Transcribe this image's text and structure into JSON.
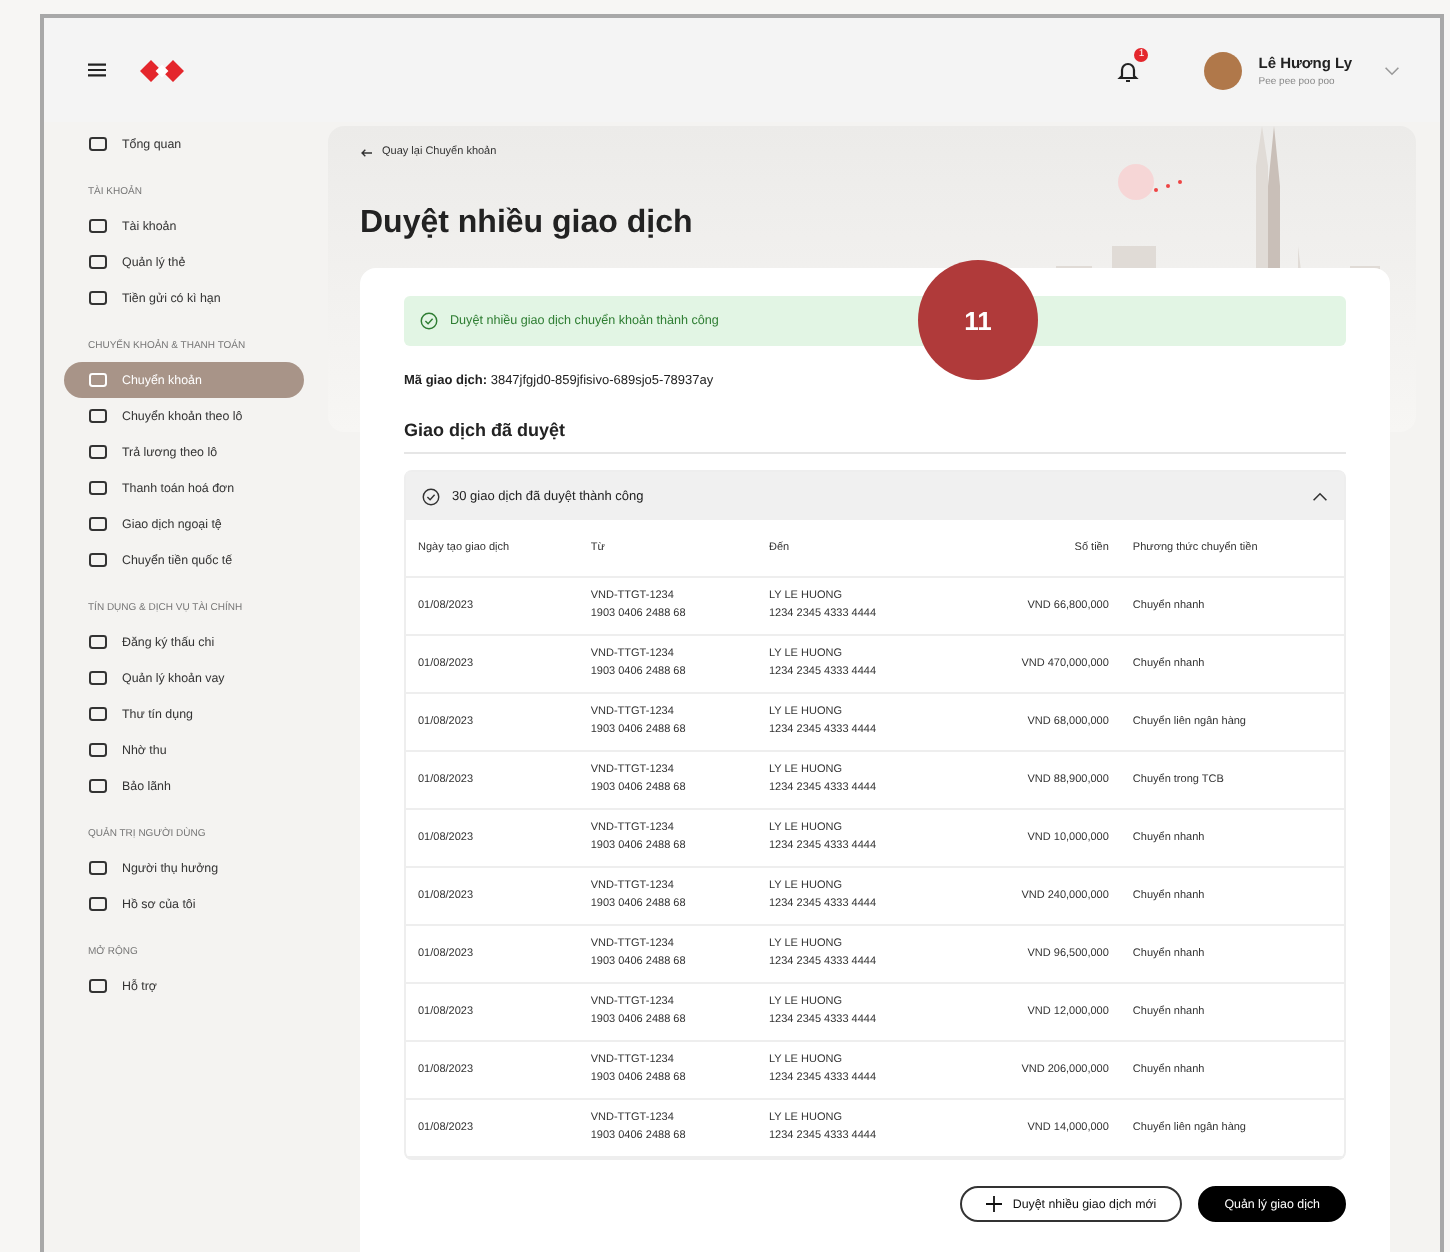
{
  "header": {
    "notification_count": "1",
    "user_name": "Lê Hương Ly",
    "user_subtitle": "Pee pee poo poo"
  },
  "sidebar": {
    "sections": [
      {
        "items": [
          {
            "label": "Tổng quan",
            "selected": false
          }
        ]
      },
      {
        "heading": "TÀI KHOẢN",
        "items": [
          {
            "label": "Tài khoản",
            "selected": false
          },
          {
            "label": "Quản lý thẻ",
            "selected": false
          },
          {
            "label": "Tiền gửi có kì hạn",
            "selected": false
          }
        ]
      },
      {
        "heading": "CHUYỂN KHOẢN & THANH TOÁN",
        "items": [
          {
            "label": "Chuyển khoản",
            "selected": true
          },
          {
            "label": "Chuyển khoản theo lô",
            "selected": false
          },
          {
            "label": "Trả lương theo lô",
            "selected": false
          },
          {
            "label": "Thanh toán hoá đơn",
            "selected": false
          },
          {
            "label": "Giao dịch ngoại tệ",
            "selected": false
          },
          {
            "label": "Chuyển tiền quốc tế",
            "selected": false
          }
        ]
      },
      {
        "heading": "TÍN DỤNG & DỊCH VỤ TÀI CHÍNH",
        "items": [
          {
            "label": "Đăng ký thấu chi",
            "selected": false
          },
          {
            "label": "Quản lý khoản vay",
            "selected": false
          },
          {
            "label": "Thư tín dụng",
            "selected": false
          },
          {
            "label": "Nhờ thu",
            "selected": false
          },
          {
            "label": "Bảo lãnh",
            "selected": false
          }
        ]
      },
      {
        "heading": "QUẢN TRỊ NGƯỜI DÙNG",
        "items": [
          {
            "label": "Người thụ hưởng",
            "selected": false
          },
          {
            "label": "Hồ sơ của tôi",
            "selected": false
          }
        ]
      },
      {
        "heading": "MỞ RỘNG",
        "items": [
          {
            "label": "Hỗ trợ",
            "selected": false
          }
        ]
      }
    ]
  },
  "back_link": "Quay lại Chuyển khoản",
  "title": "Duyệt nhiều giao dịch",
  "success_message": "Duyệt nhiều giao dịch chuyển khoản thành công",
  "transaction_id": "**Mã giao dịch:** 3847jfgjd0-859jfisivo-689sjo5-78937ay",
  "section_title": "Giao dịch đã duyệt",
  "accordion": {
    "label": "30 giao dịch đã duyệt thành công",
    "expanded": true
  },
  "step_marker": "11",
  "table": {
    "columns": [
      "Ngày tạo giao dịch",
      "Từ",
      "Đến",
      "Số tiền",
      "Phương thức chuyển tiền"
    ],
    "rows": [
      {
        "date": "01/08/2023",
        "from": [
          "VND-TTGT-1234",
          "1903 0406 2488 68"
        ],
        "to": [
          "LY LE HUONG",
          "1234 2345 4333 4444"
        ],
        "amount": "VND 66,800,000",
        "method": "Chuyển nhanh"
      },
      {
        "date": "01/08/2023",
        "from": [
          "VND-TTGT-1234",
          "1903 0406 2488 68"
        ],
        "to": [
          "LY LE HUONG",
          "1234 2345 4333 4444"
        ],
        "amount": "VND 470,000,000",
        "method": "Chuyển nhanh"
      },
      {
        "date": "01/08/2023",
        "from": [
          "VND-TTGT-1234",
          "1903 0406 2488 68"
        ],
        "to": [
          "LY LE HUONG",
          "1234 2345 4333 4444"
        ],
        "amount": "VND 68,000,000",
        "method": "Chuyển liên ngân hàng"
      },
      {
        "date": "01/08/2023",
        "from": [
          "VND-TTGT-1234",
          "1903 0406 2488 68"
        ],
        "to": [
          "LY LE HUONG",
          "1234 2345 4333 4444"
        ],
        "amount": "VND 88,900,000",
        "method": "Chuyển trong TCB"
      },
      {
        "date": "01/08/2023",
        "from": [
          "VND-TTGT-1234",
          "1903 0406 2488 68"
        ],
        "to": [
          "LY LE HUONG",
          "1234 2345 4333 4444"
        ],
        "amount": "VND 10,000,000",
        "method": "Chuyển nhanh"
      },
      {
        "date": "01/08/2023",
        "from": [
          "VND-TTGT-1234",
          "1903 0406 2488 68"
        ],
        "to": [
          "LY LE HUONG",
          "1234 2345 4333 4444"
        ],
        "amount": "VND 240,000,000",
        "method": "Chuyển nhanh"
      },
      {
        "date": "01/08/2023",
        "from": [
          "VND-TTGT-1234",
          "1903 0406 2488 68"
        ],
        "to": [
          "LY LE HUONG",
          "1234 2345 4333 4444"
        ],
        "amount": "VND 96,500,000",
        "method": "Chuyển nhanh"
      },
      {
        "date": "01/08/2023",
        "from": [
          "VND-TTGT-1234",
          "1903 0406 2488 68"
        ],
        "to": [
          "LY LE HUONG",
          "1234 2345 4333 4444"
        ],
        "amount": "VND 12,000,000",
        "method": "Chuyển nhanh"
      },
      {
        "date": "01/08/2023",
        "from": [
          "VND-TTGT-1234",
          "1903 0406 2488 68"
        ],
        "to": [
          "LY LE HUONG",
          "1234 2345 4333 4444"
        ],
        "amount": "VND 206,000,000",
        "method": "Chuyển nhanh"
      },
      {
        "date": "01/08/2023",
        "from": [
          "VND-TTGT-1234",
          "1903 0406 2488 68"
        ],
        "to": [
          "LY LE HUONG",
          "1234 2345 4333 4444"
        ],
        "amount": "VND 14,000,000",
        "method": "Chuyển liên ngân hàng"
      }
    ]
  },
  "buttons": [
    {
      "label": "Duyệt nhiều giao dịch mới",
      "kind": "outline"
    },
    {
      "label": "Quản lý giao dịch",
      "kind": "primary"
    }
  ]
}
